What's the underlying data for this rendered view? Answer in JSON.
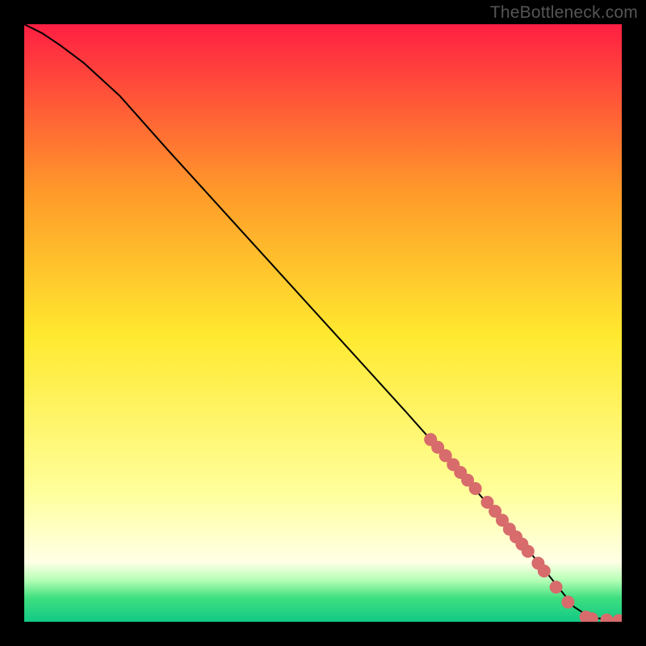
{
  "attribution": "TheBottleneck.com",
  "colors": {
    "background": "#000000",
    "marker": "#d86b6b",
    "curve": "#000000",
    "gradient_top": "#ff1f43",
    "gradient_mid_upper": "#ff9a2a",
    "gradient_mid": "#ffe92f",
    "gradient_mid_lower": "#ffff9a",
    "gradient_lower": "#ffffe6",
    "gradient_green_light": "#b6ffb6",
    "gradient_green": "#3fdf7f",
    "gradient_green_dark": "#12c985"
  },
  "chart_data": {
    "type": "line",
    "title": "",
    "xlabel": "",
    "ylabel": "",
    "xlim": [
      0,
      100
    ],
    "ylim": [
      0,
      100
    ],
    "series": [
      {
        "name": "curve",
        "x": [
          0,
          3,
          6,
          10,
          16,
          24,
          34,
          44,
          54,
          64,
          72,
          80,
          86,
          90,
          92,
          94,
          96,
          98,
          100
        ],
        "y": [
          100,
          98.5,
          96.5,
          93.5,
          88,
          79,
          68,
          57,
          46,
          35,
          26,
          17,
          10,
          5,
          2.5,
          1.2,
          0.6,
          0.3,
          0.2
        ]
      }
    ],
    "markers": [
      {
        "x": 68.0,
        "y": 30.5
      },
      {
        "x": 69.2,
        "y": 29.2
      },
      {
        "x": 70.5,
        "y": 27.8
      },
      {
        "x": 71.8,
        "y": 26.3
      },
      {
        "x": 73.0,
        "y": 25.0
      },
      {
        "x": 74.2,
        "y": 23.7
      },
      {
        "x": 75.5,
        "y": 22.3
      },
      {
        "x": 77.5,
        "y": 20.0
      },
      {
        "x": 78.8,
        "y": 18.5
      },
      {
        "x": 80.0,
        "y": 17.0
      },
      {
        "x": 81.2,
        "y": 15.5
      },
      {
        "x": 82.3,
        "y": 14.2
      },
      {
        "x": 83.3,
        "y": 13.0
      },
      {
        "x": 84.3,
        "y": 11.8
      },
      {
        "x": 86.0,
        "y": 9.8
      },
      {
        "x": 87.0,
        "y": 8.5
      },
      {
        "x": 89.0,
        "y": 5.8
      },
      {
        "x": 91.0,
        "y": 3.3
      },
      {
        "x": 94.0,
        "y": 0.8
      },
      {
        "x": 95.0,
        "y": 0.5
      },
      {
        "x": 97.5,
        "y": 0.3
      },
      {
        "x": 99.5,
        "y": 0.2
      }
    ],
    "marker_radius": 8
  }
}
